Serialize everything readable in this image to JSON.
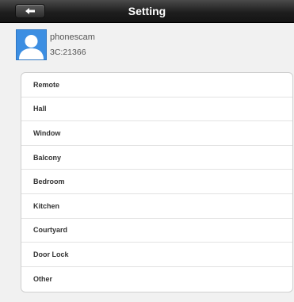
{
  "header": {
    "title": "Setting",
    "back_icon": "back-arrow-icon"
  },
  "profile": {
    "name": "phonescam",
    "id": "3C:21366",
    "avatar_icon": "user-avatar-icon"
  },
  "list": {
    "items": [
      {
        "label": "Remote"
      },
      {
        "label": "Hall"
      },
      {
        "label": "Window"
      },
      {
        "label": "Balcony"
      },
      {
        "label": "Bedroom"
      },
      {
        "label": "Kitchen"
      },
      {
        "label": "Courtyard"
      },
      {
        "label": "Door Lock"
      },
      {
        "label": "Other"
      }
    ]
  },
  "colors": {
    "titlebar": "#1e1e1e",
    "avatar": "#3c8ee2",
    "background": "#f1f1f1"
  }
}
